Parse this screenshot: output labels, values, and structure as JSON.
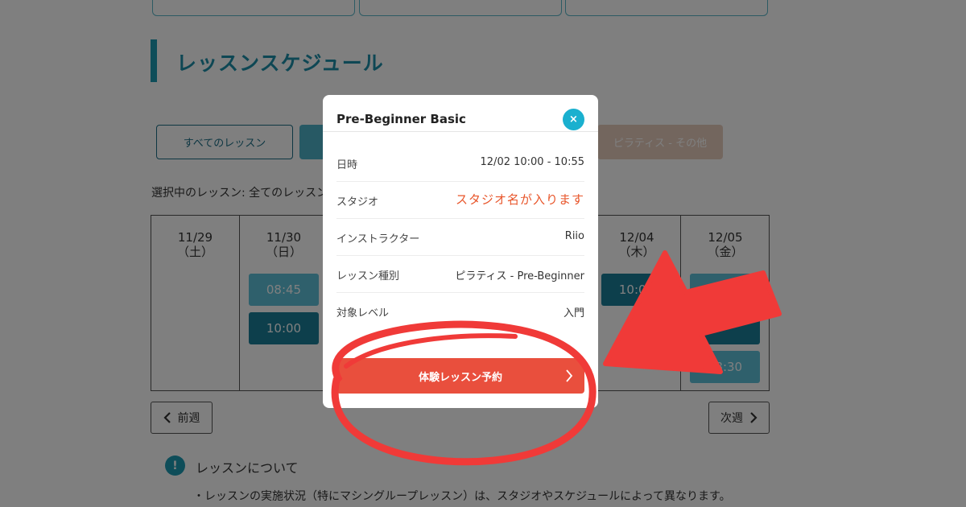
{
  "section": {
    "title": "レッスンスケジュール"
  },
  "filters": {
    "all_label": "すべてのレッスン",
    "pilates_other_label": "ピラティス - その他"
  },
  "selected": {
    "label": "選択中のレッスン: 全てのレッスン"
  },
  "schedule": {
    "days": [
      {
        "date": "11/29",
        "weekday": "（土）",
        "slots": []
      },
      {
        "date": "11/30",
        "weekday": "（日）",
        "slots": [
          {
            "time": "08:45",
            "tone": "light"
          },
          {
            "time": "10:00",
            "tone": "dark"
          }
        ]
      },
      {
        "date": "",
        "weekday": "",
        "slots": []
      },
      {
        "date": "",
        "weekday": "",
        "slots": []
      },
      {
        "date": "",
        "weekday": "",
        "slots": []
      },
      {
        "date": "12/04",
        "weekday": "（木）",
        "slots": [
          {
            "time": "10:00",
            "tone": "dark"
          }
        ]
      },
      {
        "date": "12/05",
        "weekday": "（金）",
        "slots": [
          {
            "time": "10:00",
            "tone": "light"
          },
          {
            "time": "",
            "tone": "dark"
          },
          {
            "time": "18:30",
            "tone": "light"
          }
        ]
      }
    ]
  },
  "nav": {
    "prev_label": "前週",
    "next_label": "次週"
  },
  "info": {
    "icon_glyph": "!",
    "title": "レッスンについて",
    "text": "・レッスンの実施状況（特にマシングループレッスン）は、スタジオやスケジュールによって異なります。"
  },
  "modal": {
    "title": "Pre-Beginner Basic",
    "close_glyph": "×",
    "rows": [
      {
        "label": "日時",
        "value": "12/02 10:00 - 10:55"
      },
      {
        "label": "スタジオ",
        "value": "スタジオ名が入ります"
      },
      {
        "label": "インストラクター",
        "value": "Riio"
      },
      {
        "label": "レッスン種別",
        "value": "ピラティス - Pre-Beginner"
      },
      {
        "label": "対象レベル",
        "value": "入門"
      }
    ],
    "cta_label": "体験レッスン予約"
  },
  "colors": {
    "accent_teal": "#1c9ab3",
    "cta_red": "#e94f3d",
    "studio_value": "#e8552a",
    "annotation_red": "#f03a38"
  }
}
